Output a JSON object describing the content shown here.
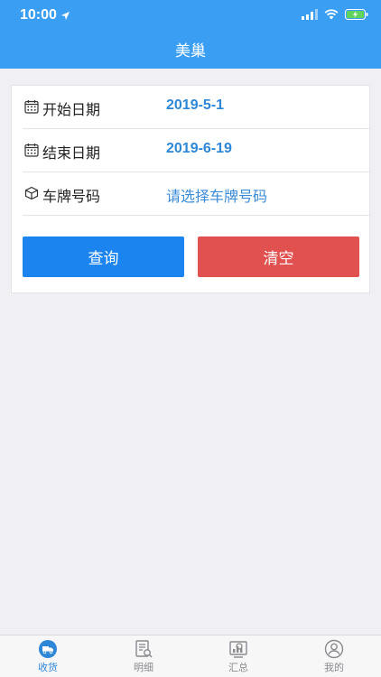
{
  "status_bar": {
    "time": "10:00"
  },
  "header": {
    "title": "美巢"
  },
  "form": {
    "rows": [
      {
        "icon": "calendar-icon",
        "label": "开始日期",
        "value": "2019-5-1"
      },
      {
        "icon": "calendar-icon",
        "label": "结束日期",
        "value": "2019-6-19"
      },
      {
        "icon": "box-icon",
        "label": "车牌号码",
        "value": "请选择车牌号码"
      }
    ],
    "query_label": "查询",
    "clear_label": "清空"
  },
  "tabs": [
    {
      "label": "收货",
      "icon": "truck-receive-icon",
      "active": true
    },
    {
      "label": "明细",
      "icon": "document-search-icon",
      "active": false
    },
    {
      "label": "汇总",
      "icon": "chart-summary-icon",
      "active": false
    },
    {
      "label": "我的",
      "icon": "user-icon",
      "active": false
    }
  ],
  "colors": {
    "header": "#3a9ff3",
    "value_text": "#2e86d6",
    "query_button": "#1b84ee",
    "clear_button": "#e0514f",
    "background": "#efeff4"
  }
}
